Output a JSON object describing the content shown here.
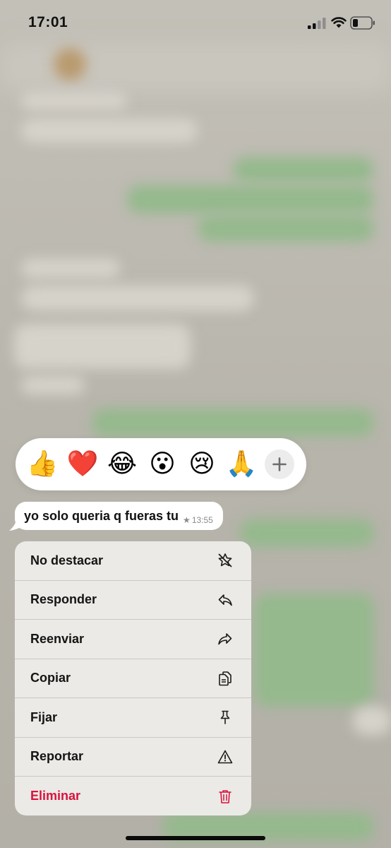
{
  "status_bar": {
    "time": "17:01",
    "icons": [
      "signal-icon",
      "wifi-icon",
      "battery-icon"
    ]
  },
  "reactions": {
    "items": [
      {
        "emoji": "👍",
        "name": "thumbs-up"
      },
      {
        "emoji": "❤️",
        "name": "red-heart"
      },
      {
        "emoji": "😂",
        "name": "tears-of-joy"
      },
      {
        "emoji": "😮",
        "name": "surprised-face"
      },
      {
        "emoji": "😢",
        "name": "crying-face"
      },
      {
        "emoji": "🙏",
        "name": "folded-hands"
      }
    ],
    "more_icon": "plus-icon"
  },
  "message": {
    "text": "yo solo queria q fueras tu",
    "starred": true,
    "time": "13:55"
  },
  "menu": {
    "items": [
      {
        "label": "No destacar",
        "icon": "unstar-icon"
      },
      {
        "label": "Responder",
        "icon": "reply-icon"
      },
      {
        "label": "Reenviar",
        "icon": "forward-icon"
      },
      {
        "label": "Copiar",
        "icon": "copy-icon"
      },
      {
        "label": "Fijar",
        "icon": "pin-icon"
      },
      {
        "label": "Reportar",
        "icon": "warning-icon"
      },
      {
        "label": "Eliminar",
        "icon": "trash-icon",
        "destructive": true
      }
    ]
  },
  "colors": {
    "destructive": "#d8123f",
    "outgoing_bubble": "#95b98d",
    "menu_background": "#ecebe8"
  }
}
